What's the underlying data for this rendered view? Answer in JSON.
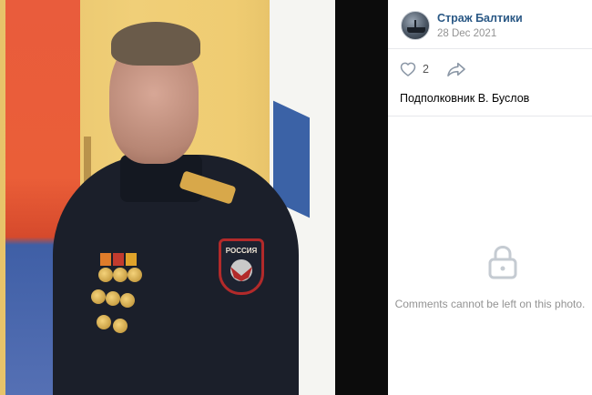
{
  "post": {
    "group_name": "Страж Балтики",
    "date": "28 Dec 2021",
    "likes": "2",
    "caption": "Подполковник В. Буслов"
  },
  "photo": {
    "patch_text": "РОССИЯ"
  },
  "comments": {
    "message": "Comments cannot be left on this photo."
  },
  "icons": {
    "like": "heart-icon",
    "share": "share-arrow-icon",
    "lock": "lock-icon"
  },
  "colors": {
    "link": "#2a5885",
    "muted": "#939393",
    "divider": "#e7e8ec"
  }
}
